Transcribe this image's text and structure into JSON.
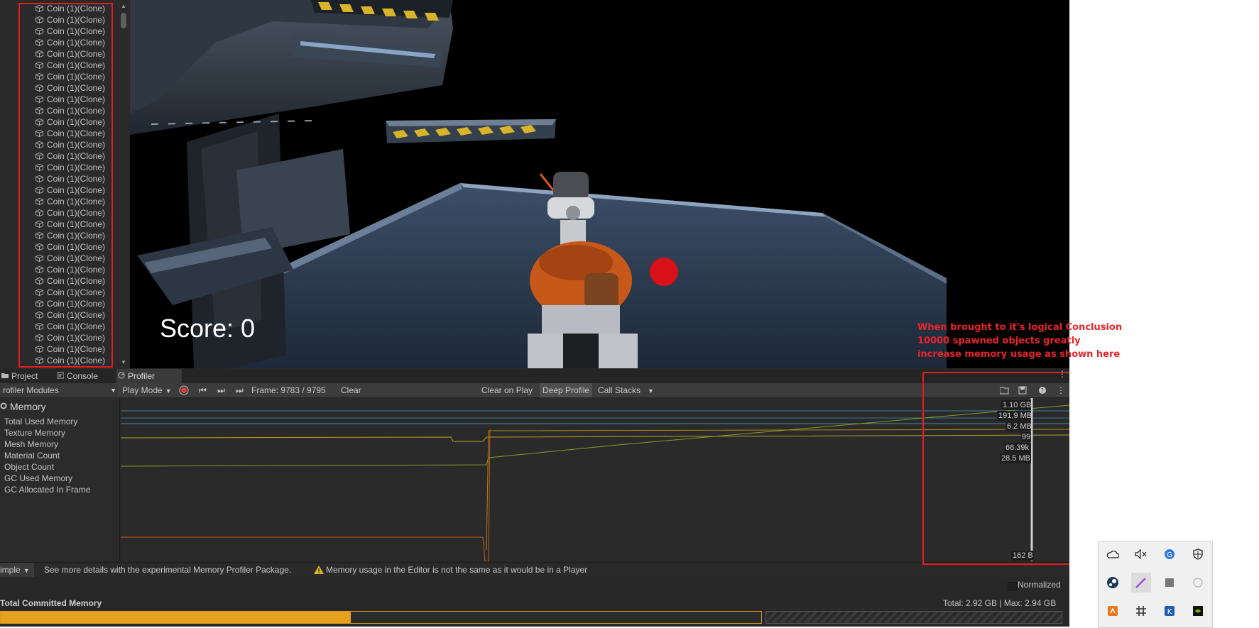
{
  "hierarchy": {
    "items": [
      "Coin (1)(Clone)",
      "Coin (1)(Clone)",
      "Coin (1)(Clone)",
      "Coin (1)(Clone)",
      "Coin (1)(Clone)",
      "Coin (1)(Clone)",
      "Coin (1)(Clone)",
      "Coin (1)(Clone)",
      "Coin (1)(Clone)",
      "Coin (1)(Clone)",
      "Coin (1)(Clone)",
      "Coin (1)(Clone)",
      "Coin (1)(Clone)",
      "Coin (1)(Clone)",
      "Coin (1)(Clone)",
      "Coin (1)(Clone)",
      "Coin (1)(Clone)",
      "Coin (1)(Clone)",
      "Coin (1)(Clone)",
      "Coin (1)(Clone)",
      "Coin (1)(Clone)",
      "Coin (1)(Clone)",
      "Coin (1)(Clone)",
      "Coin (1)(Clone)",
      "Coin (1)(Clone)",
      "Coin (1)(Clone)",
      "Coin (1)(Clone)",
      "Coin (1)(Clone)",
      "Coin (1)(Clone)",
      "Coin (1)(Clone)",
      "Coin (1)(Clone)",
      "Coin (1)(Clone)"
    ]
  },
  "game": {
    "score": "Score: 0"
  },
  "annotation": {
    "lines": [
      "When brought to it's logical Conclusion",
      "10000 spawned objects greatly",
      "increase memory usage as shown here"
    ],
    "color": "#e8242a"
  },
  "tabs": {
    "project": "Project",
    "console": "Console",
    "profiler": "Profiler"
  },
  "toolbar": {
    "modules": "rofiler Modules",
    "play_mode": "Play Mode",
    "frame": "Frame: 9783 / 9795",
    "clear": "Clear",
    "clear_on_play": "Clear on Play",
    "deep_profile": "Deep Profile",
    "call_stacks": "Call Stacks"
  },
  "memory": {
    "title": "Memory",
    "metrics": [
      "Total Used Memory",
      "Texture Memory",
      "Mesh Memory",
      "Material Count",
      "Object Count",
      "GC Used Memory",
      "GC Allocated In Frame"
    ]
  },
  "chart_data": {
    "type": "line",
    "frame_range": [
      9483,
      9795
    ],
    "current_frame": 9783,
    "readouts": [
      "1.10 GB",
      "191.9 MB",
      "6.2 MB",
      "99",
      "66.39k",
      "28.5 MB",
      "162 B"
    ]
  },
  "status": {
    "view": "imple",
    "details": "See more details with the experimental Memory Profiler Package.",
    "warning": "Memory usage in the Editor is not the same as it would be in a Player"
  },
  "normalized": {
    "label": "Normalized"
  },
  "committed": {
    "title": "Total Committed Memory",
    "total": "Total: 2.92 GB | Max: 2.94 GB",
    "fill_fraction": 0.46,
    "fill_color": "#e5a11e"
  }
}
